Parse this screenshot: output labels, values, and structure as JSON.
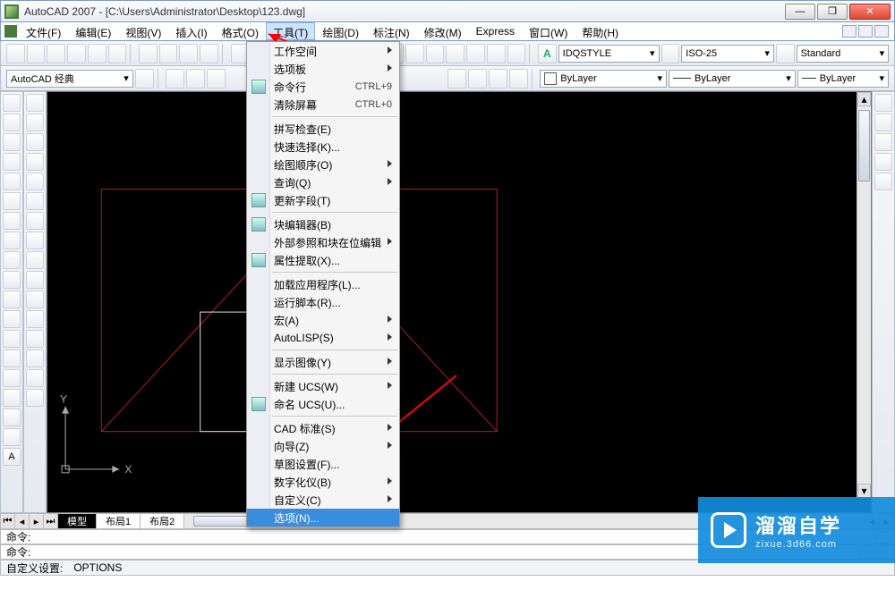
{
  "title": "AutoCAD 2007 - [C:\\Users\\Administrator\\Desktop\\123.dwg]",
  "menu": {
    "file": "文件(F)",
    "edit": "编辑(E)",
    "view": "视图(V)",
    "insert": "插入(I)",
    "format": "格式(O)",
    "tools": "工具(T)",
    "draw": "绘图(D)",
    "dim": "标注(N)",
    "modify": "修改(M)",
    "express": "Express",
    "window": "窗口(W)",
    "help": "帮助(H)"
  },
  "style_combos": {
    "workspace": "AutoCAD 经典",
    "dimstyle_icon": "A",
    "dimstyle": "IDQSTYLE",
    "dimstyle2": "ISO-25",
    "textstyle": "Standard",
    "layer": "ByLayer",
    "ltype": "ByLayer",
    "lweight": "ByLayer"
  },
  "tools_menu": [
    {
      "label": "工作空间",
      "sub": true
    },
    {
      "label": "选项板",
      "sub": true
    },
    {
      "label": "命令行",
      "kb": "CTRL+9",
      "icon": true
    },
    {
      "label": "清除屏幕",
      "kb": "CTRL+0"
    },
    {
      "sep": true
    },
    {
      "label": "拼写检查(E)"
    },
    {
      "label": "快速选择(K)..."
    },
    {
      "label": "绘图顺序(O)",
      "sub": true
    },
    {
      "label": "查询(Q)",
      "sub": true
    },
    {
      "label": "更新字段(T)",
      "icon": true
    },
    {
      "sep": true
    },
    {
      "label": "块编辑器(B)",
      "icon": true
    },
    {
      "label": "外部参照和块在位编辑",
      "sub": true
    },
    {
      "label": "属性提取(X)...",
      "icon": true
    },
    {
      "sep": true
    },
    {
      "label": "加载应用程序(L)..."
    },
    {
      "label": "运行脚本(R)..."
    },
    {
      "label": "宏(A)",
      "sub": true
    },
    {
      "label": "AutoLISP(S)",
      "sub": true
    },
    {
      "sep": true
    },
    {
      "label": "显示图像(Y)",
      "sub": true
    },
    {
      "sep": true
    },
    {
      "label": "新建 UCS(W)",
      "sub": true
    },
    {
      "label": "命名 UCS(U)...",
      "icon": true
    },
    {
      "sep": true
    },
    {
      "label": "CAD 标准(S)",
      "sub": true
    },
    {
      "label": "向导(Z)",
      "sub": true
    },
    {
      "label": "草图设置(F)..."
    },
    {
      "label": "数字化仪(B)",
      "sub": true
    },
    {
      "label": "自定义(C)",
      "sub": true
    },
    {
      "label": "选项(N)...",
      "hl": true
    }
  ],
  "tabs": {
    "model": "模型",
    "layout1": "布局1",
    "layout2": "布局2"
  },
  "axis": {
    "x": "X",
    "y": "Y"
  },
  "cmd": {
    "prompt": "命令:"
  },
  "status": {
    "label": "自定义设置:",
    "value": "OPTIONS"
  },
  "watermark": {
    "big": "溜溜自学",
    "small": "zixue.3d66.com"
  }
}
